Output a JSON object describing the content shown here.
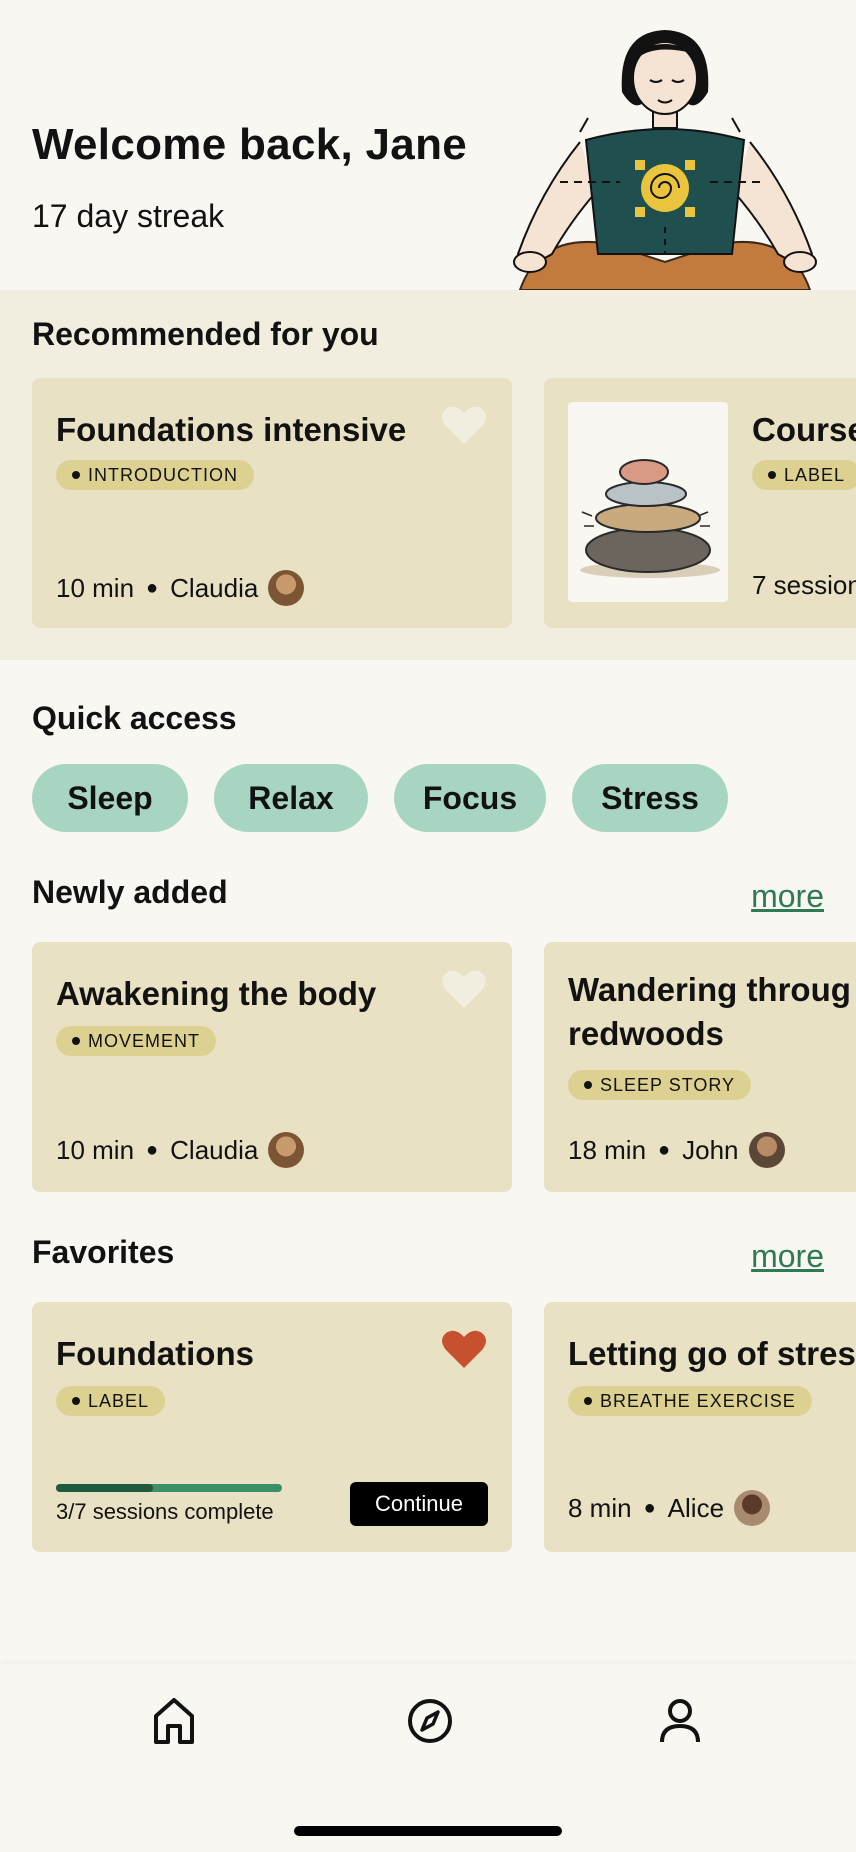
{
  "header": {
    "welcome": "Welcome back, Jane",
    "streak": "17 day streak"
  },
  "recommended": {
    "title": "Recommended for you",
    "cards": [
      {
        "title": "Foundations intensive",
        "tag": "INTRODUCTION",
        "duration": "10 min",
        "author": "Claudia",
        "favorite": false
      },
      {
        "title": "Course",
        "tag": "LABEL",
        "meta": "7 session"
      }
    ]
  },
  "quick_access": {
    "title": "Quick access",
    "items": [
      "Sleep",
      "Relax",
      "Focus",
      "Stress"
    ]
  },
  "newly_added": {
    "title": "Newly added",
    "more": "more",
    "cards": [
      {
        "title": "Awakening the body",
        "tag": "MOVEMENT",
        "duration": "10 min",
        "author": "Claudia",
        "favorite": false
      },
      {
        "title_line1": "Wandering throug",
        "title_line2": "redwoods",
        "tag": "SLEEP STORY",
        "duration": "18 min",
        "author": "John"
      }
    ]
  },
  "favorites": {
    "title": "Favorites",
    "more": "more",
    "cards": [
      {
        "title": "Foundations",
        "tag": "LABEL",
        "progress_text": "3/7 sessions complete",
        "progress": 0.43,
        "button": "Continue",
        "favorite": true
      },
      {
        "title": "Letting go of stress",
        "tag": "BREATHE EXERCISE",
        "duration": "8 min",
        "author": "Alice"
      }
    ]
  },
  "nav": {
    "icons": [
      "home-icon",
      "compass-icon",
      "profile-icon"
    ]
  },
  "colors": {
    "background": "#f9f7f1",
    "band": "#f2eedf",
    "card": "#e8e1c4",
    "tag": "#ddd192",
    "pill": "#a8d5c2",
    "link": "#2d7a55",
    "heart_active": "#c7502e",
    "heart_inactive": "#f2eedf"
  }
}
